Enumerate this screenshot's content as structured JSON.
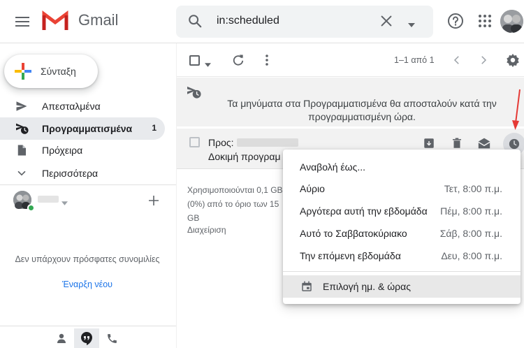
{
  "app": {
    "name": "Gmail"
  },
  "search": {
    "value": "in:scheduled"
  },
  "compose": {
    "label": "Σύνταξη"
  },
  "sidebar": {
    "items": [
      {
        "label": "Απεσταλμένα",
        "icon": "send-icon"
      },
      {
        "label": "Προγραμματισμένα",
        "icon": "scheduled-icon",
        "count": "1",
        "active": true
      },
      {
        "label": "Πρόχειρα",
        "icon": "draft-icon"
      },
      {
        "label": "Περισσότερα",
        "icon": "chevron-down-icon"
      }
    ]
  },
  "hangouts": {
    "empty_text": "Δεν υπάρχουν πρόσφατες συνομιλίες",
    "new_link": "Έναρξη νέου"
  },
  "toolbar": {
    "page_range": "1–1 από 1"
  },
  "banner": {
    "text": "Τα μηνύματα στα Προγραμματισμένα θα αποσταλούν κατά την προγραμματισμένη ώρα."
  },
  "mail": {
    "to_label": "Προς:",
    "subject": "Δοκιμή προγραμ"
  },
  "storage": {
    "lines": [
      "Χρησιμοποιούνται 0,1 GB",
      "(0%) από το όριο των 15",
      "GB"
    ],
    "manage": "Διαχείριση"
  },
  "snooze_menu": {
    "title": "Αναβολή έως...",
    "options": [
      {
        "label": "Αύριο",
        "time": "Τετ, 8:00 π.μ."
      },
      {
        "label": "Αργότερα αυτή την εβδομάδα",
        "time": "Πέμ, 8:00 π.μ."
      },
      {
        "label": "Αυτό το Σαββατοκύριακο",
        "time": "Σάβ, 8:00 π.μ."
      },
      {
        "label": "Την επόμενη εβδομάδα",
        "time": "Δευ, 8:00 π.μ."
      }
    ],
    "custom": "Επιλογή ημ. & ώρας"
  },
  "colors": {
    "accent_blue": "#1a73e8",
    "gmail_red": "#ea4335",
    "online_green": "#34a853",
    "annotation_red": "#e53935"
  }
}
